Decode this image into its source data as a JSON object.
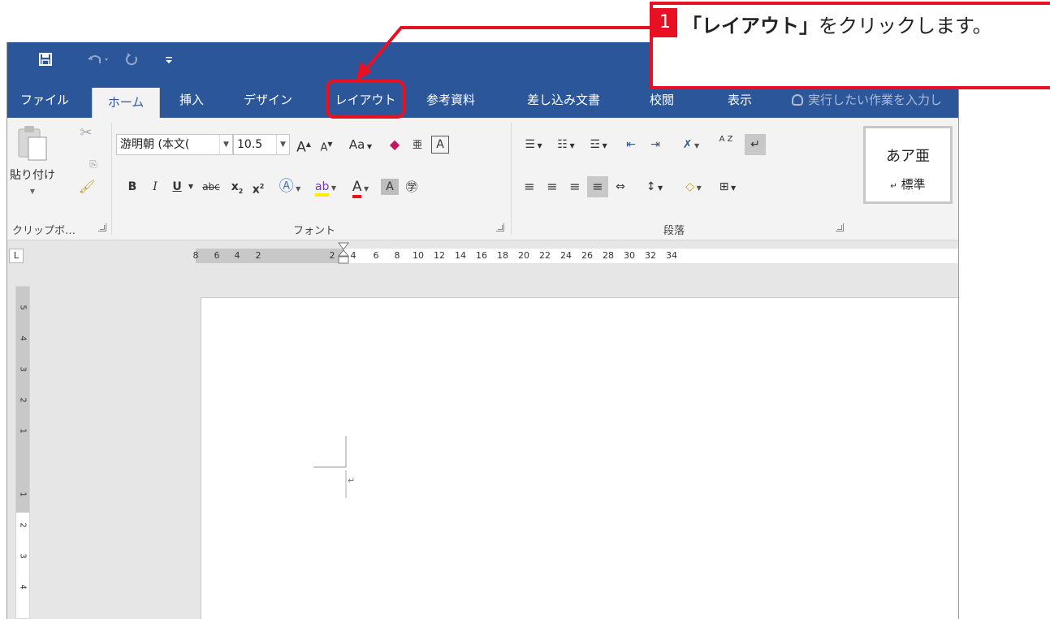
{
  "quick_access": {
    "save_icon": "save-icon",
    "undo_icon": "undo-icon",
    "redo_icon": "redo-icon",
    "customize_icon": "customize-qat-icon"
  },
  "tabs": [
    {
      "label": "ファイル"
    },
    {
      "label": "ホーム"
    },
    {
      "label": "挿入"
    },
    {
      "label": "デザイン"
    },
    {
      "label": "レイアウト"
    },
    {
      "label": "参考資料"
    },
    {
      "label": "差し込み文書"
    },
    {
      "label": "校閲"
    },
    {
      "label": "表示"
    }
  ],
  "tell_me": "実行したい作業を入力し",
  "clipboard": {
    "paste_label": "貼り付け",
    "group_label": "クリップボ…"
  },
  "font": {
    "font_name": "游明朝 (本文(",
    "font_size": "10.5",
    "grow": "A",
    "shrink": "A",
    "change_case": "Aa",
    "bold": "B",
    "italic": "I",
    "underline": "U",
    "strike": "abc",
    "subscript": "x",
    "superscript": "x",
    "group_label": "フォント"
  },
  "paragraph": {
    "group_label": "段落",
    "sort": "A Z"
  },
  "styles": {
    "sample_text": "あア亜",
    "style_name": "標準"
  },
  "hruler_numbers": [
    "8",
    "6",
    "4",
    "2",
    "2",
    "4",
    "6",
    "8",
    "10",
    "12",
    "14",
    "16",
    "18",
    "20",
    "22",
    "24",
    "26",
    "28",
    "30",
    "32",
    "34"
  ],
  "vruler_numbers": [
    "5",
    "4",
    "3",
    "2",
    "1",
    "1",
    "2",
    "3",
    "4"
  ],
  "tab_selector": "L",
  "callout": {
    "number": "1",
    "bold_text": "「レイアウト」",
    "text": "をクリックします。",
    "color": "#e81123"
  },
  "theme": {
    "title_bar": "#2b579a",
    "ribbon": "#f3f3f3"
  }
}
